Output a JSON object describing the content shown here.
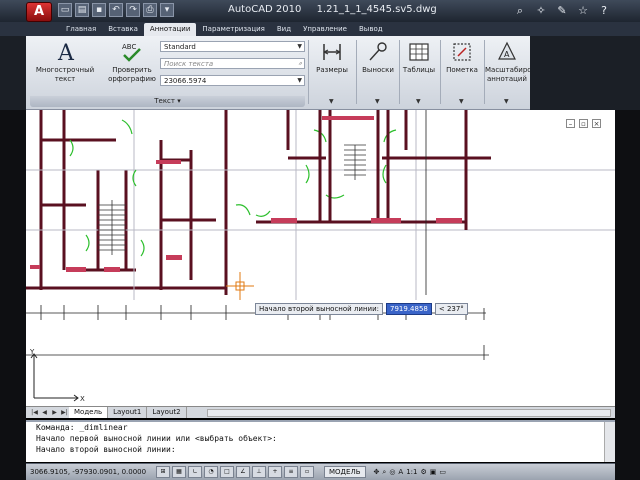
{
  "titlebar": {
    "app_button": "A",
    "title": "AutoCAD 2010",
    "file": "1.21_1_1_4545.sv5.dwg",
    "qat_icons": [
      "new-icon",
      "open-icon",
      "save-icon",
      "undo-icon",
      "redo-icon",
      "print-icon",
      "dropdown-icon"
    ],
    "right_icons": [
      "binoculars-icon",
      "star-icon",
      "tools-icon",
      "star-icon",
      "help-icon"
    ]
  },
  "tabs": [
    "Главная",
    "Вставка",
    "Аннотации",
    "Параметризация",
    "Вид",
    "Управление",
    "Вывод"
  ],
  "ribbon": {
    "mtext_label": "Многострочный текст",
    "spell_label": "Проверить орфографию",
    "text_style": "Standard",
    "search_placeholder": "Поиск текста",
    "text_height": "23066.5974",
    "panel_title": "Текст",
    "dim_label": "Размеры",
    "leaders_label": "Выноски",
    "tables_label": "Таблицы",
    "markup_label": "Пометка",
    "scale_label": "Масштабирование аннотаций"
  },
  "tooltip": {
    "label": "Начало второй выносной линии:",
    "value": "7919.4858",
    "angle": "< 237°"
  },
  "layout_tabs": [
    "Модель",
    "Layout1",
    "Layout2"
  ],
  "command": [
    "Команда: _dimlinear",
    "Начало первой выносной линии или <выбрать объект>:",
    "Начало второй выносной линии:"
  ],
  "status": {
    "coords": "3066.9105, -97930.0901, 0.0000",
    "model": "МОДЕЛЬ",
    "scale": "1:1"
  }
}
